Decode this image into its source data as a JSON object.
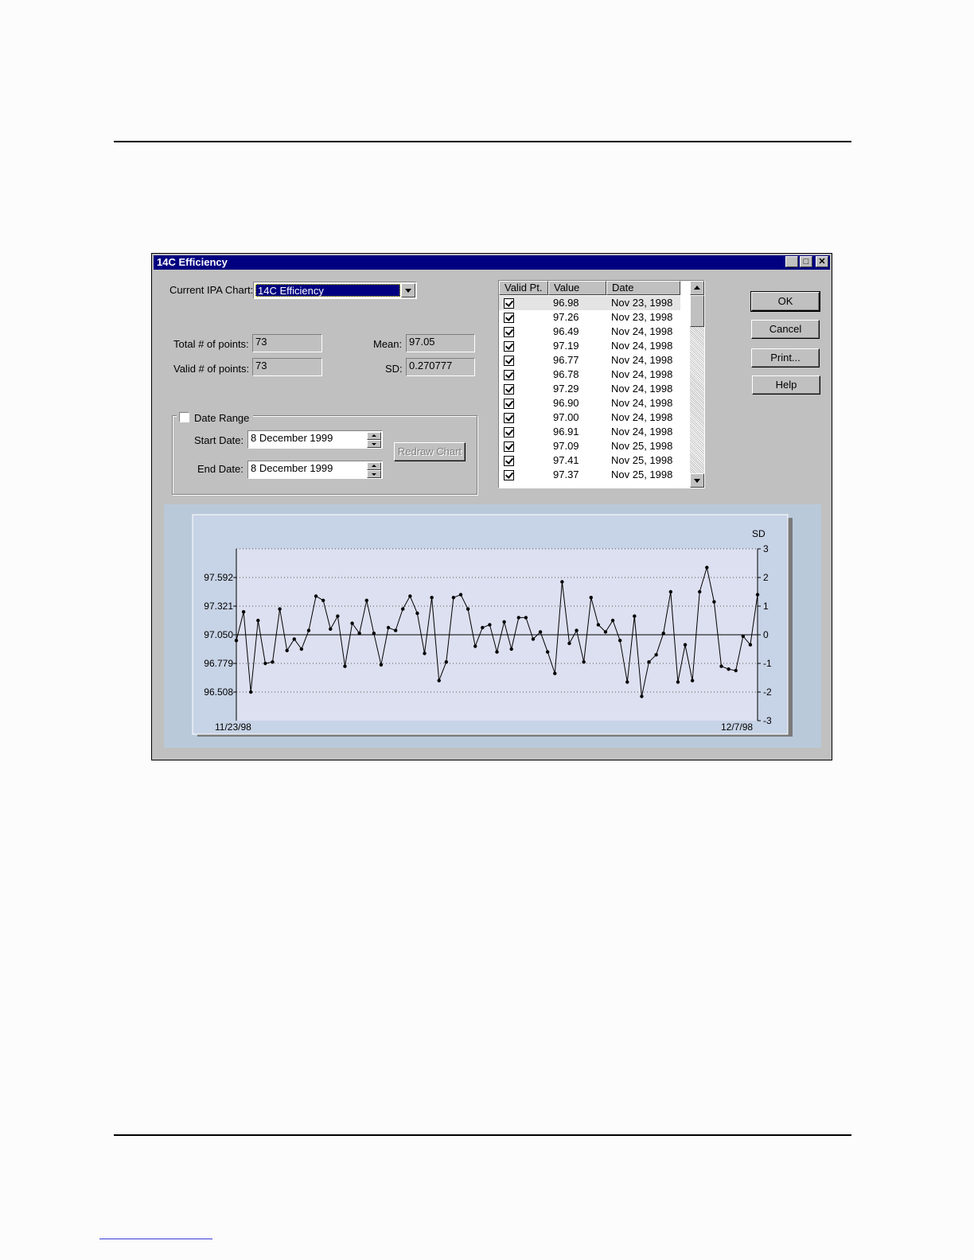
{
  "window": {
    "title": "14C Efficiency"
  },
  "form": {
    "current_chart_label": "Current IPA Chart:",
    "current_chart_value": "14C Efficiency",
    "total_points_label": "Total # of points:",
    "total_points_value": "73",
    "valid_points_label": "Valid # of points:",
    "valid_points_value": "73",
    "mean_label": "Mean:",
    "mean_value": "97.05",
    "sd_label": "SD:",
    "sd_value": "0.270777",
    "date_range_label": "Date Range",
    "date_range_checked": false,
    "start_date_label": "Start Date:",
    "start_date_value": "8  December 1999",
    "end_date_label": "End Date:",
    "end_date_value": "8  December 1999",
    "redraw_label": "Redraw Chart"
  },
  "buttons": {
    "ok": "OK",
    "cancel": "Cancel",
    "print": "Print...",
    "help": "Help"
  },
  "list": {
    "headers": [
      "Valid Pt.",
      "Value",
      "Date"
    ],
    "rows": [
      {
        "value": "96.98",
        "date": "Nov 23, 1998"
      },
      {
        "value": "97.26",
        "date": "Nov 23, 1998"
      },
      {
        "value": "96.49",
        "date": "Nov 24, 1998"
      },
      {
        "value": "97.19",
        "date": "Nov 24, 1998"
      },
      {
        "value": "96.77",
        "date": "Nov 24, 1998"
      },
      {
        "value": "96.78",
        "date": "Nov 24, 1998"
      },
      {
        "value": "97.29",
        "date": "Nov 24, 1998"
      },
      {
        "value": "96.90",
        "date": "Nov 24, 1998"
      },
      {
        "value": "97.00",
        "date": "Nov 24, 1998"
      },
      {
        "value": "96.91",
        "date": "Nov 24, 1998"
      },
      {
        "value": "97.09",
        "date": "Nov 25, 1998"
      },
      {
        "value": "97.41",
        "date": "Nov 25, 1998"
      },
      {
        "value": "97.37",
        "date": "Nov 25, 1998"
      }
    ]
  },
  "chart_data": {
    "type": "line",
    "y_ticks": [
      "97.592",
      "97.321",
      "97.050",
      "96.779",
      "96.508"
    ],
    "y_tick_values": [
      97.592,
      97.321,
      97.05,
      96.779,
      96.508
    ],
    "sd_label": "SD",
    "sd_ticks": [
      "3",
      "2",
      "1",
      "0",
      "-1",
      "-2",
      "-3"
    ],
    "sd_tick_values": [
      3,
      2,
      1,
      0,
      -1,
      -2,
      -3
    ],
    "x_start_label": "11/23/98",
    "x_end_label": "12/7/98",
    "mean": 97.05,
    "sd": 0.270777,
    "ylim_sd": [
      -3,
      3
    ],
    "grid": true,
    "values_sd": [
      -0.2,
      0.8,
      -2,
      0.5,
      -1,
      -0.95,
      0.9,
      -0.55,
      -0.15,
      -0.5,
      0.15,
      1.35,
      1.2,
      0.2,
      0.65,
      -1.1,
      0.4,
      0.05,
      1.2,
      0.05,
      -1.05,
      0.25,
      0.15,
      0.9,
      1.35,
      0.75,
      -0.65,
      1.3,
      -1.6,
      -0.95,
      1.3,
      1.4,
      0.9,
      -0.4,
      0.25,
      0.35,
      -0.6,
      0.45,
      -0.5,
      0.6,
      0.6,
      -0.15,
      0.1,
      -0.6,
      -1.35,
      1.85,
      -0.3,
      0.15,
      -0.95,
      1.3,
      0.35,
      0.1,
      0.5,
      -0.2,
      -1.65,
      0.65,
      -2.15,
      -0.95,
      -0.7,
      0.05,
      1.5,
      -1.65,
      -0.35,
      -1.6,
      1.5,
      2.35,
      1.15,
      -1.1,
      -1.2,
      -1.25,
      -0.05,
      -0.35,
      1.4
    ]
  }
}
